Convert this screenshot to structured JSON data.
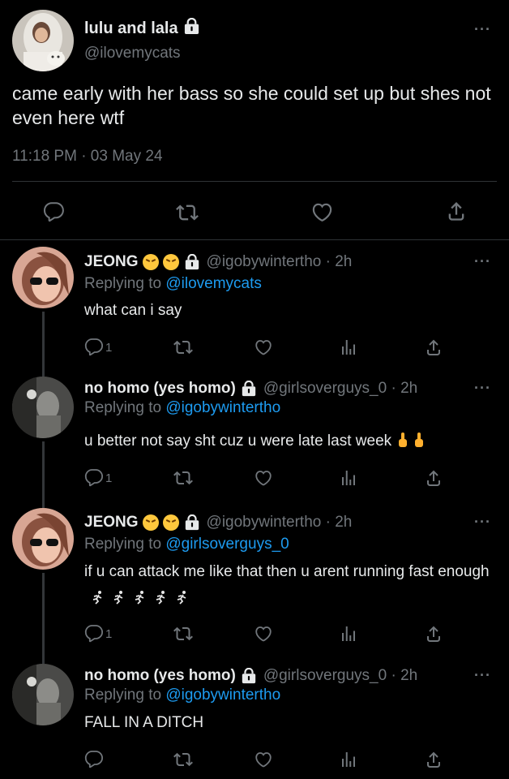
{
  "main_tweet": {
    "display_name": "lulu and lala",
    "handle": "@ilovemycats",
    "text": "came early with her bass so she could set up but shes not even here wtf",
    "timestamp": "11:18 PM · 03 May 24"
  },
  "replies": [
    {
      "display_name": "JEONG",
      "handle_time": "@igobywintertho · 2h",
      "replying_prefix": "Replying to ",
      "replying_to": "@ilovemycats",
      "text": "what can i say",
      "reply_count": "1"
    },
    {
      "display_name": "no homo (yes homo)",
      "handle_time": "@girlsoverguys_0 · 2h",
      "replying_prefix": "Replying to ",
      "replying_to": "@igobywintertho",
      "text": "u better not say sht cuz u were late last week",
      "reply_count": "1"
    },
    {
      "display_name": "JEONG",
      "handle_time": "@igobywintertho · 2h",
      "replying_prefix": "Replying to ",
      "replying_to": "@girlsoverguys_0",
      "text": "if u can attack me like that then u arent running fast enough",
      "reply_count": "1"
    },
    {
      "display_name": "no homo (yes homo)",
      "handle_time": "@girlsoverguys_0 · 2h",
      "replying_prefix": "Replying to ",
      "replying_to": "@igobywintertho",
      "text": "FALL IN A DITCH",
      "reply_count": ""
    }
  ],
  "more_icon": "···",
  "colors": {
    "background": "#000000",
    "text": "#e7e9ea",
    "muted": "#71767b",
    "link": "#1d9bf0",
    "divider": "#2f3336"
  },
  "icons": [
    "reply-icon",
    "retweet-icon",
    "like-icon",
    "share-icon",
    "views-icon",
    "lock-icon",
    "more-icon"
  ]
}
